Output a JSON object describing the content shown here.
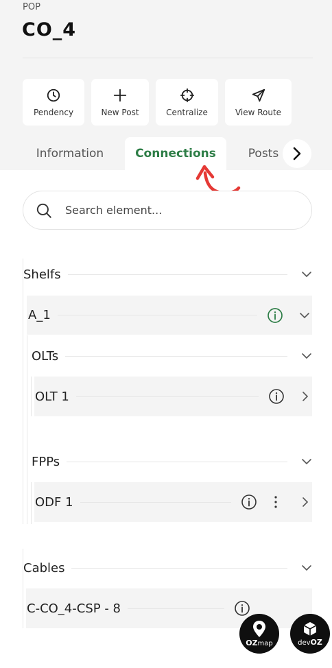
{
  "header": {
    "kicker": "POP",
    "title": "CO_4"
  },
  "actions": [
    {
      "label": "Pendency",
      "icon": "clock-icon"
    },
    {
      "label": "New Post",
      "icon": "plus-icon"
    },
    {
      "label": "Centralize",
      "icon": "crosshair-icon"
    },
    {
      "label": "View Route",
      "icon": "navigation-arrow-icon"
    }
  ],
  "tabs": {
    "information": "Information",
    "connections": "Connections",
    "posts": "Posts",
    "active": "Connections"
  },
  "search": {
    "placeholder": "Search element..."
  },
  "tree": {
    "shelfs": {
      "label": "Shelfs",
      "a1": {
        "label": "A_1",
        "olts": {
          "label": "OLTs",
          "items": [
            "OLT 1"
          ]
        },
        "fpps": {
          "label": "FPPs",
          "items": [
            "ODF 1"
          ]
        }
      }
    },
    "cables": {
      "label": "Cables",
      "items": [
        "C-CO_4-CSP - 8"
      ]
    }
  },
  "brand": {
    "ozmap": {
      "oz": "OZ",
      "map": "map"
    },
    "devoz": {
      "dev": "dev",
      "oz": "OZ"
    }
  },
  "colors": {
    "accent_green": "#2d7d46",
    "annotation_red": "#e53935",
    "header_bg": "#f4f4f4"
  }
}
